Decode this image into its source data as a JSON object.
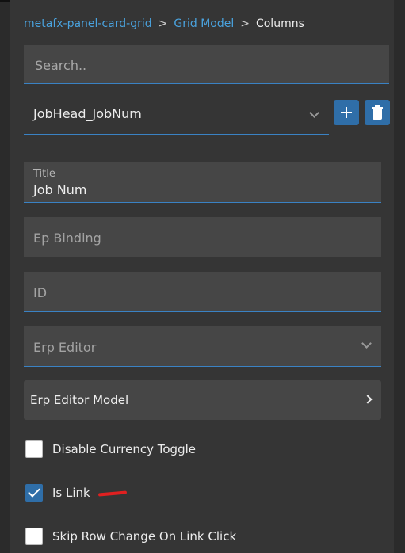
{
  "breadcrumb": {
    "items": [
      "metafx-panel-card-grid",
      "Grid Model",
      "Columns"
    ],
    "separator": ">"
  },
  "search": {
    "placeholder": "Search..",
    "value": ""
  },
  "column_select": {
    "value": "JobHead_JobNum"
  },
  "fields": {
    "title": {
      "label": "Title",
      "value": "Job Num"
    },
    "ep_binding": {
      "placeholder": "Ep Binding"
    },
    "id": {
      "placeholder": "ID"
    },
    "erp_editor": {
      "placeholder": "Erp Editor"
    }
  },
  "editor_model": {
    "label": "Erp Editor Model"
  },
  "checkboxes": [
    {
      "label": "Disable Currency Toggle",
      "checked": false
    },
    {
      "label": "Is Link",
      "checked": true
    },
    {
      "label": "Skip Row Change On Link Click",
      "checked": false
    }
  ],
  "icons": {
    "add": "plus-icon",
    "delete": "trash-icon",
    "dropdown": "chevron-down-icon",
    "navigate": "chevron-right-icon"
  },
  "colors": {
    "accent": "#2f6ea8",
    "link": "#4aa3df",
    "underline": "#3a82c4",
    "background": "#353535",
    "annotation": "#e02020"
  }
}
